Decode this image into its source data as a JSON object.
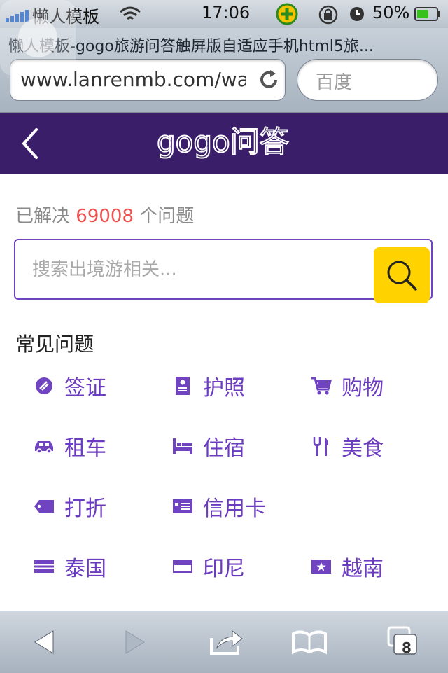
{
  "status_bar": {
    "carrier": "懒人模板",
    "time": "17:06",
    "battery": "50%"
  },
  "browser": {
    "page_title": "懒人模板-gogo旅游问答触屏版自适应手机html5旅...",
    "url": "www.lanrenmb.com/wap",
    "search_placeholder": "百度",
    "tab_count": "8"
  },
  "header": {
    "logo": "gogo问答"
  },
  "stats": {
    "prefix": "已解决",
    "count": "69008",
    "suffix": "个问题"
  },
  "search": {
    "placeholder": "搜索出境游相关..."
  },
  "section": {
    "title": "常见问题"
  },
  "categories": [
    {
      "label": "签证",
      "icon": "visa-icon"
    },
    {
      "label": "护照",
      "icon": "passport-icon"
    },
    {
      "label": "购物",
      "icon": "shopping-cart-icon"
    },
    {
      "label": "租车",
      "icon": "car-icon"
    },
    {
      "label": "住宿",
      "icon": "bed-icon"
    },
    {
      "label": "美食",
      "icon": "fork-knife-icon"
    },
    {
      "label": "打折",
      "icon": "tag-icon"
    },
    {
      "label": "信用卡",
      "icon": "credit-card-icon"
    },
    {
      "label": "泰国",
      "icon": "flag-icon"
    },
    {
      "label": "印尼",
      "icon": "flag-icon"
    },
    {
      "label": "越南",
      "icon": "star-flag-icon"
    }
  ],
  "colors": {
    "header_bg": "#3b1e6a",
    "accent": "#6b3bc0",
    "search_button": "#ffd200",
    "count_red": "#ef5050"
  }
}
